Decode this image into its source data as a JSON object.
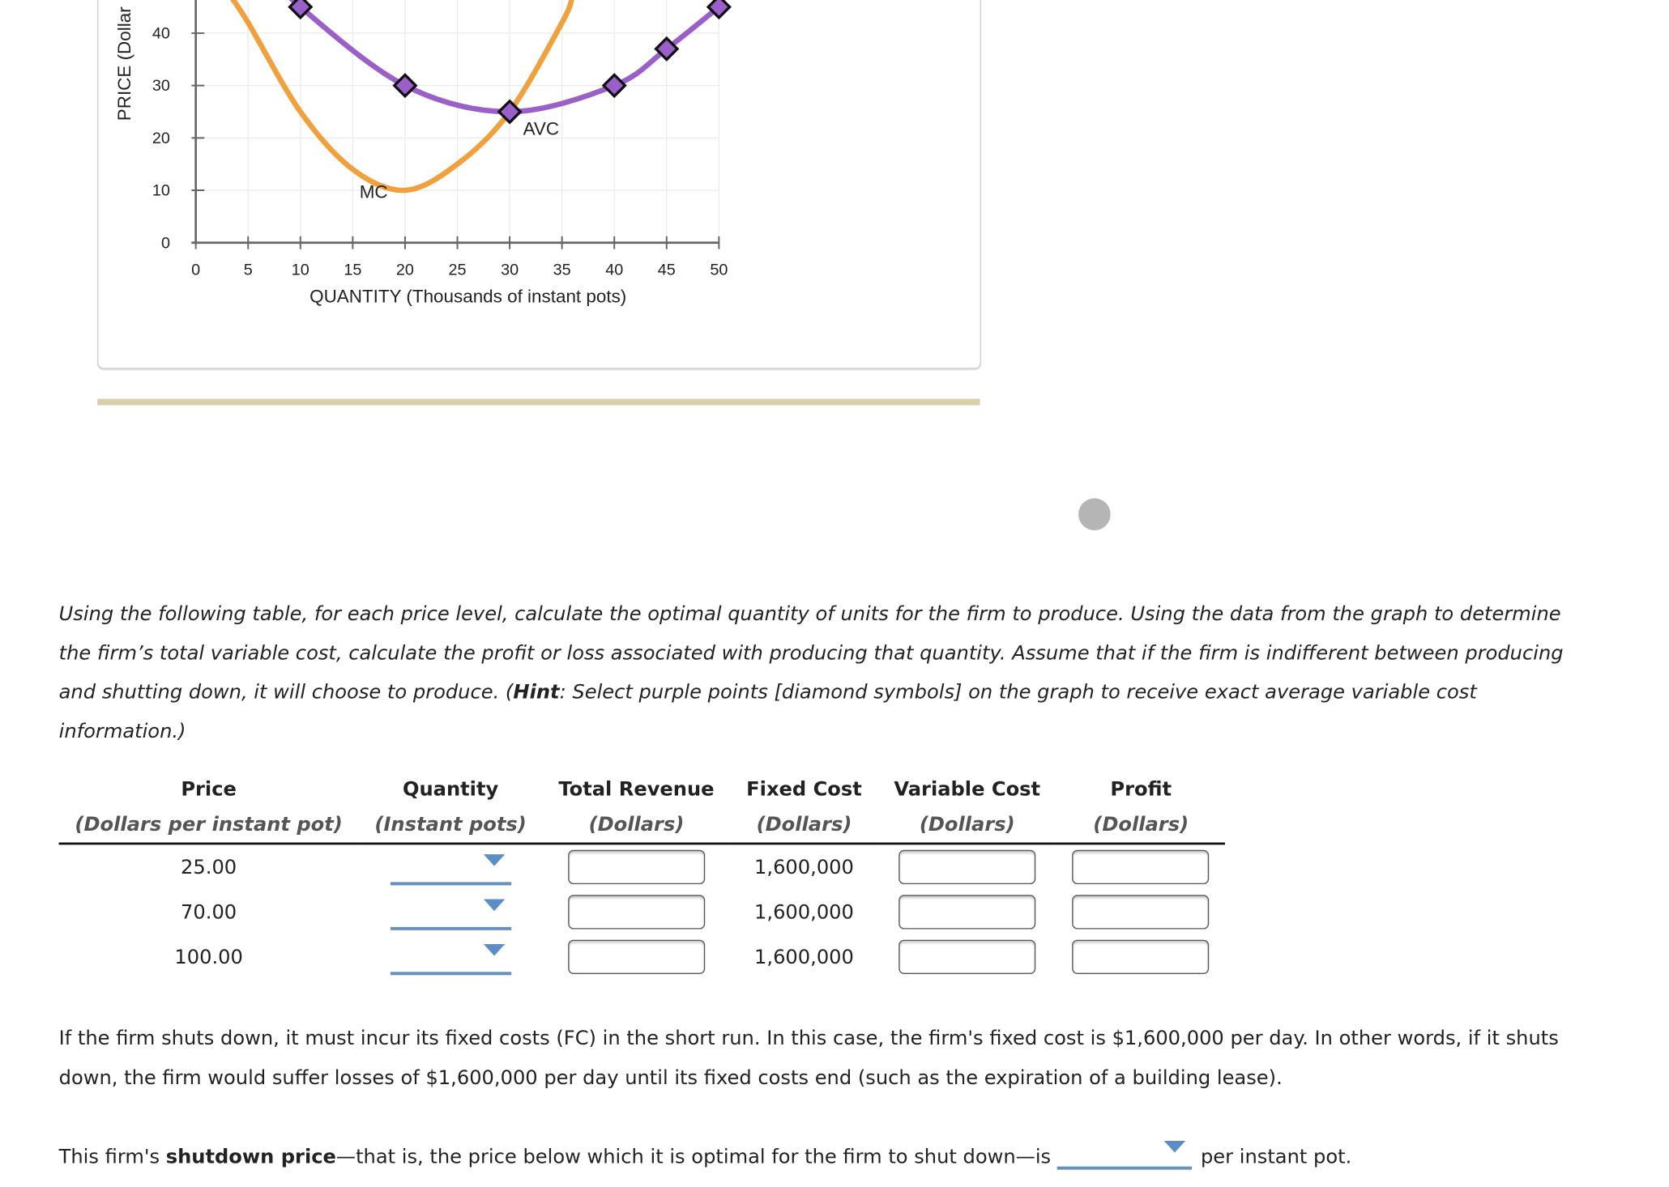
{
  "graph": {
    "panel_note": "Graph panel (top cropped)"
  },
  "chart_data": {
    "type": "line",
    "title": "",
    "xlabel": "QUANTITY (Thousands of instant pots)",
    "ylabel": "PRICE (Dollars per instant pot)",
    "ylabel_visible": "PRICE (Dollar",
    "x_ticks": [
      0,
      5,
      10,
      15,
      20,
      25,
      30,
      35,
      40,
      45,
      50
    ],
    "y_ticks": [
      0,
      10,
      20,
      30,
      40
    ],
    "xlim": [
      0,
      50
    ],
    "ylim_visible": [
      0,
      46
    ],
    "grid": true,
    "series": [
      {
        "name": "AVC",
        "color": "#9b5fc9",
        "marker": "diamond",
        "x": [
          10,
          20,
          30,
          40,
          45,
          50
        ],
        "y": [
          45,
          30,
          25,
          30,
          37,
          45
        ]
      },
      {
        "name": "MC",
        "color": "#f0a03c",
        "marker": "none",
        "x": [
          3,
          5,
          10,
          15,
          20,
          25,
          30,
          35,
          36
        ],
        "y": [
          48,
          42,
          25,
          14,
          10,
          15,
          25,
          42,
          47
        ]
      }
    ],
    "annotations": [
      {
        "text": "MC",
        "x": 17,
        "y": 10
      },
      {
        "text": "AVC",
        "x": 33,
        "y": 22
      }
    ]
  },
  "instructions": {
    "part1": "Using the following table, for each price level, calculate the optimal quantity of units for the firm to produce. Using the data from the graph to determine the firm’s total variable cost, calculate the profit or loss associated with producing that quantity. Assume that if the firm is indifferent between producing and shutting down, it will choose to produce. (",
    "hint_label": "Hint",
    "part2": ": Select purple points [diamond symbols] on the graph to receive exact average variable cost information.)"
  },
  "table": {
    "headers": [
      {
        "title": "Price",
        "unit": "(Dollars per instant pot)"
      },
      {
        "title": "Quantity",
        "unit": "(Instant pots)"
      },
      {
        "title": "Total Revenue",
        "unit": "(Dollars)"
      },
      {
        "title": "Fixed Cost",
        "unit": "(Dollars)"
      },
      {
        "title": "Variable Cost",
        "unit": "(Dollars)"
      },
      {
        "title": "Profit",
        "unit": "(Dollars)"
      }
    ],
    "rows": [
      {
        "price": "25.00",
        "quantity": "",
        "total_revenue": "",
        "fixed_cost": "1,600,000",
        "variable_cost": "",
        "profit": ""
      },
      {
        "price": "70.00",
        "quantity": "",
        "total_revenue": "",
        "fixed_cost": "1,600,000",
        "variable_cost": "",
        "profit": ""
      },
      {
        "price": "100.00",
        "quantity": "",
        "total_revenue": "",
        "fixed_cost": "1,600,000",
        "variable_cost": "",
        "profit": ""
      }
    ]
  },
  "shutdown_text": "If the firm shuts down, it must incur its fixed costs (FC) in the short run. In this case, the firm's fixed cost is $1,600,000 per day. In other words, if it shuts down, the firm would suffer losses of $1,600,000 per day until its fixed costs end (such as the expiration of a building lease).",
  "shutdown_question": {
    "prefix": "This firm's ",
    "bold": "shutdown price",
    "middle": "—that is, the price below which it is optimal for the firm to shut down—is",
    "selected": "",
    "suffix": "per instant pot."
  },
  "colors": {
    "avc": "#9b5fc9",
    "mc": "#f0a03c",
    "dropdown": "#5b8dc7",
    "divider": "#d9cfab"
  }
}
